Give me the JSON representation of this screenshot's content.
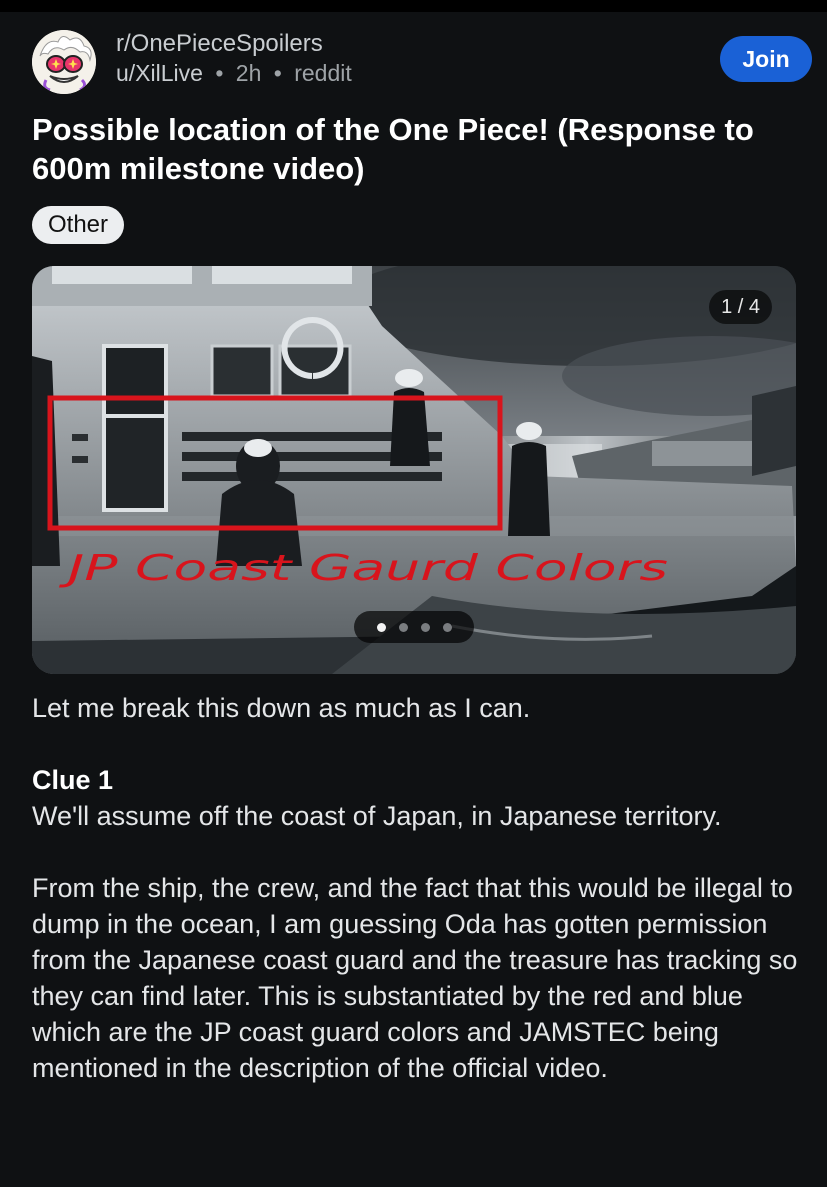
{
  "header": {
    "subreddit": "r/OnePieceSpoilers",
    "username": "u/XilLive",
    "separator": "•",
    "age": "2h",
    "source": "reddit",
    "join_label": "Join"
  },
  "post": {
    "title": "Possible location of the One Piece! (Response to 600m milestone video)",
    "flair": "Other"
  },
  "media": {
    "counter": "1 / 4",
    "annotation": "JP Coast Gaurd Colors",
    "annotation_color": "#d8141c",
    "current_index": 1,
    "total": 4
  },
  "body": {
    "intro": "Let me break this down as much as I can.",
    "clue_heading": "Clue 1",
    "clue_text": "We'll assume off the coast of Japan, in Japanese territory.",
    "paragraph": "From the ship, the crew, and the fact that this would be illegal to dump in the ocean, I am guessing Oda has gotten permission from the Japanese coast guard and the treasure has tracking so they can find later. This is substantiated by the red and blue which are the JP coast guard colors and JAMSTEC being mentioned in the description of the official video."
  },
  "colors": {
    "background": "#0f1113",
    "join_button": "#1a61d6",
    "flair_bg": "#eceef0"
  }
}
